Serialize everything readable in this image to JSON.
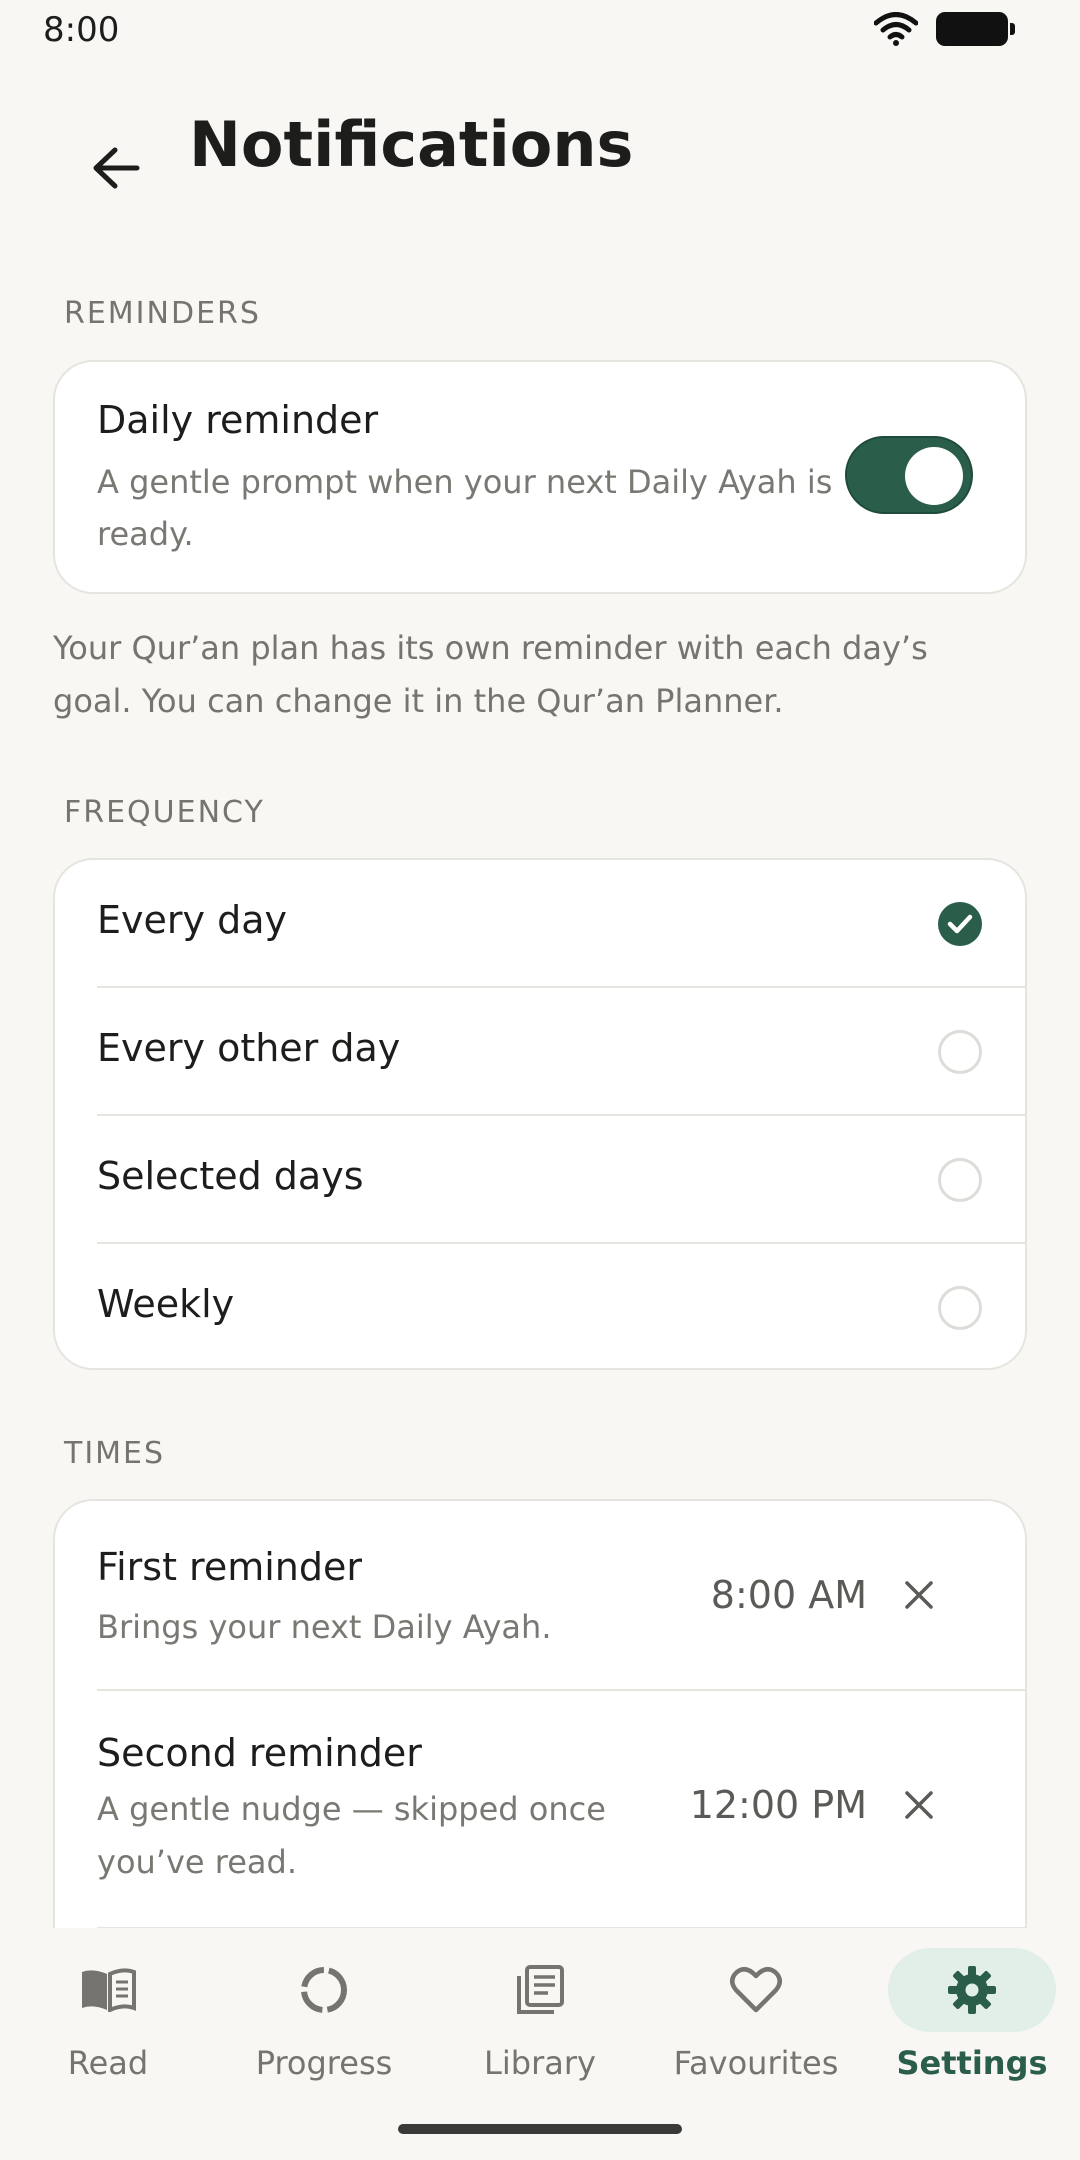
{
  "status_bar": {
    "time": "8:00"
  },
  "header": {
    "title": "Notifications"
  },
  "reminders": {
    "section_label": "REMINDERS",
    "daily_reminder": {
      "title": "Daily reminder",
      "description": "A gentle prompt when your next Daily Ayah is ready.",
      "enabled": true
    },
    "note": "Your Qur’an plan has its own reminder with each day’s goal. You can change it in the Qur’an Planner."
  },
  "frequency": {
    "section_label": "FREQUENCY",
    "options": [
      {
        "label": "Every day",
        "selected": true
      },
      {
        "label": "Every other day",
        "selected": false
      },
      {
        "label": "Selected days",
        "selected": false
      },
      {
        "label": "Weekly",
        "selected": false
      }
    ]
  },
  "times": {
    "section_label": "TIMES",
    "items": [
      {
        "title": "First reminder",
        "description": "Brings your next Daily Ayah.",
        "time": "8:00 AM"
      },
      {
        "title": "Second reminder",
        "description": "A gentle nudge — skipped once you’ve read.",
        "time": "12:00 PM"
      }
    ]
  },
  "bottom_nav": {
    "items": [
      {
        "label": "Read",
        "icon": "book-icon",
        "active": false
      },
      {
        "label": "Progress",
        "icon": "progress-ring-icon",
        "active": false
      },
      {
        "label": "Library",
        "icon": "library-icon",
        "active": false
      },
      {
        "label": "Favourites",
        "icon": "heart-icon",
        "active": false
      },
      {
        "label": "Settings",
        "icon": "gear-icon",
        "active": true
      }
    ]
  },
  "colors": {
    "accent": "#2a5e4a",
    "background": "#f8f7f4",
    "card": "#ffffff",
    "muted_text": "#76746f",
    "active_nav_pill": "#e2efe9"
  }
}
